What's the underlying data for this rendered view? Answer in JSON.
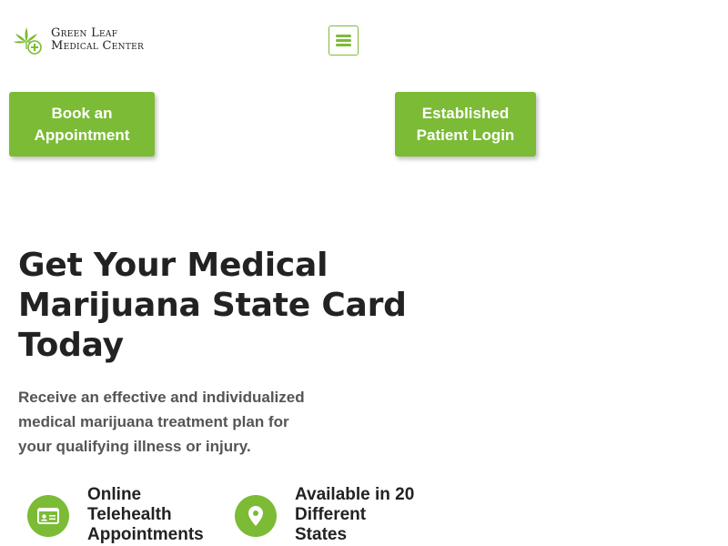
{
  "header": {
    "logo_line1": "Green Leaf",
    "logo_line2": "Medical Center",
    "logo_icon": "cannabis-leaf-plus-icon",
    "menu_icon": "hamburger-menu-icon"
  },
  "cta": {
    "book_label": "Book an\nAppointment",
    "login_label": "Established\nPatient Login"
  },
  "hero": {
    "title": "Get Your Medical Marijuana State Card Today",
    "description": "Receive an effective and individualized medical marijuana treatment plan for your qualifying illness or injury."
  },
  "features": [
    {
      "icon": "id-card-icon",
      "label": "Online\nTelehealth\nAppointments"
    },
    {
      "icon": "location-pin-icon",
      "label": "Available in 20\nDifferent\nStates"
    }
  ],
  "colors": {
    "brand_green": "#7cbb35",
    "text_dark": "#222222",
    "text_muted": "#555555"
  }
}
